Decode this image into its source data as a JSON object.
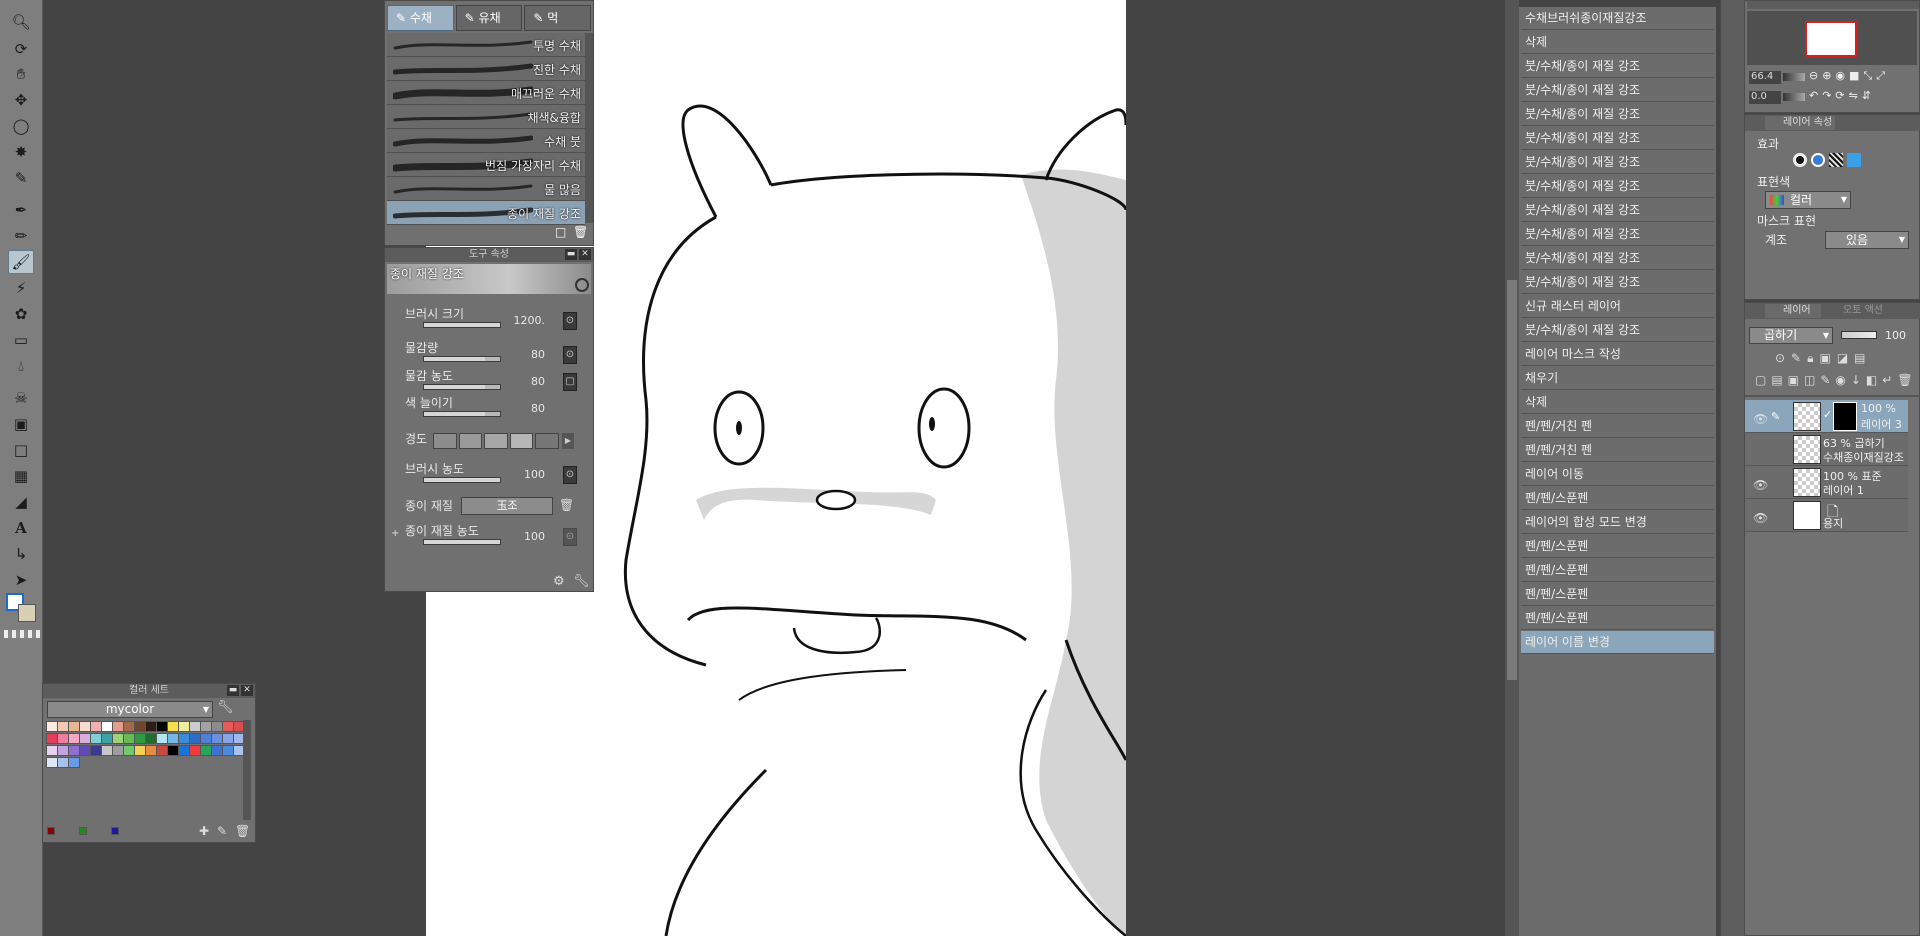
{
  "brush_tabs": [
    {
      "label": "수채"
    },
    {
      "label": "유채"
    },
    {
      "label": "먹"
    }
  ],
  "brushes": [
    {
      "name": "투명 수채"
    },
    {
      "name": "진한 수채"
    },
    {
      "name": "매끄러운 수채"
    },
    {
      "name": "채색&융합"
    },
    {
      "name": "수채 붓"
    },
    {
      "name": "번짐 가장자리 수채"
    },
    {
      "name": "물 많음"
    },
    {
      "name": "종이 재질 강조",
      "selected": true
    }
  ],
  "tool_property": {
    "title": "도구 속성",
    "preset_name": "종이 재질 강조",
    "brush_size_label": "브러시 크기",
    "brush_size_value": "1200.",
    "paint_amount_label": "물감량",
    "paint_amount_value": "80",
    "paint_density_label": "물감 농도",
    "paint_density_value": "80",
    "color_stretch_label": "색 늘이기",
    "color_stretch_value": "80",
    "hardness_label": "경도",
    "brush_density_label": "브러시 농도",
    "brush_density_value": "100",
    "paper_texture_label": "종이 재질",
    "paper_texture_value": "玉조",
    "paper_texture_density_label": "종이 재질 농도",
    "paper_texture_density_value": "100",
    "values": {
      "paint_amount_pct": 80,
      "paint_density_pct": 80,
      "color_stretch_pct": 80,
      "brush_density_pct": 100,
      "paper_texture_density_pct": 100
    }
  },
  "color_set": {
    "title": "컬러 세트",
    "set_name": "mycolor",
    "rows": [
      [
        "#fbeae0",
        "#f3c9b1",
        "#e9b694",
        "#f6dccd",
        "#f0b0b0",
        "#ffffff",
        "#e39d8c",
        "#a4694a",
        "#6c4630",
        "#2b1d15",
        "#000000",
        "#f6e04c",
        "#f0ec99",
        "#cccccc",
        "#a3a3a3",
        "#8c8c8c",
        "#e85a5a",
        "#d84e4e"
      ],
      [
        "#e63d5c",
        "#f07ca0",
        "#f5a7c4",
        "#d4b1db",
        "#7fcfd6",
        "#3fa3a5",
        "#9ad37a",
        "#66bb55",
        "#2f9a3f",
        "#1f6d2f",
        "#b5e3ef",
        "#72b9e3",
        "#3a8bd8",
        "#2d6dc8",
        "#4f7fd8",
        "#6a8fe0",
        "#86a6e8",
        "#a1b9ee"
      ],
      [
        "#e7d1ef",
        "#bfa4e0",
        "#8f6fd0",
        "#5f4bb2",
        "#3c3c8f",
        "#c7c7c7",
        "#9e9e9e",
        "#74c96b",
        "#f4d25a",
        "#e88c3d",
        "#c94a3c",
        "#000000",
        "#1b74d8",
        "#f03c3c",
        "#27a55c",
        "#3e73d1",
        "#4a8ae0",
        "#a9c2f0"
      ],
      [
        "#dfe7f6",
        "#a9c0ea",
        "#6b9be8"
      ]
    ],
    "fg_colors": [
      "#8b0000",
      "#1f8a1f",
      "#1a1aa0"
    ]
  },
  "history": [
    {
      "label": "수채브러쉬종이재질강조"
    },
    {
      "label": "삭제"
    },
    {
      "label": "붓/수채/종이 재질 강조"
    },
    {
      "label": "붓/수채/종이 재질 강조"
    },
    {
      "label": "붓/수채/종이 재질 강조"
    },
    {
      "label": "붓/수채/종이 재질 강조"
    },
    {
      "label": "붓/수채/종이 재질 강조"
    },
    {
      "label": "붓/수채/종이 재질 강조"
    },
    {
      "label": "붓/수채/종이 재질 강조"
    },
    {
      "label": "붓/수채/종이 재질 강조"
    },
    {
      "label": "붓/수채/종이 재질 강조"
    },
    {
      "label": "붓/수채/종이 재질 강조"
    },
    {
      "label": "신규 래스터 레이어"
    },
    {
      "label": "붓/수채/종이 재질 강조"
    },
    {
      "label": "레이어 마스크 작성"
    },
    {
      "label": "채우기"
    },
    {
      "label": "삭제"
    },
    {
      "label": "펜/펜/거친 펜"
    },
    {
      "label": "펜/펜/거친 펜"
    },
    {
      "label": "레이어 이동"
    },
    {
      "label": "펜/펜/스푼펜"
    },
    {
      "label": "레이어의 합성 모드 변경"
    },
    {
      "label": "펜/펜/스푼펜"
    },
    {
      "label": "펜/펜/스푼펜"
    },
    {
      "label": "펜/펜/스푼펜"
    },
    {
      "label": "펜/펜/스푼펜"
    },
    {
      "label": "레이어 이름 변경",
      "selected": true
    }
  ],
  "navigator": {
    "zoom": "66.4",
    "rotation": "0.0"
  },
  "layer_property": {
    "tab_label": "레이어 속성",
    "effect_label": "효과",
    "expression_color_label": "표현색",
    "expression_color_value": "컬러",
    "mask_expression_label": "마스크 표현",
    "tone_label": "계조",
    "tone_value": "있음"
  },
  "layers_panel": {
    "tab_label": "레이어",
    "tab2_label": "오토 액션",
    "blend_mode": "곱하기",
    "opacity": "100",
    "layers": [
      {
        "line1": "100 %",
        "line2": "레이어 3",
        "visible": true,
        "selected": true
      },
      {
        "line1": "63 %  곱하기",
        "line2": "수채종이재질강조",
        "visible": false
      },
      {
        "line1": "100 %  표준",
        "line2": "레이어 1",
        "visible": true
      },
      {
        "line1": "",
        "line2": "용지",
        "visible": true
      }
    ]
  },
  "colors": {
    "selection": "#8ba6ba",
    "panel": "#707070",
    "canvas": "#ffffff"
  }
}
